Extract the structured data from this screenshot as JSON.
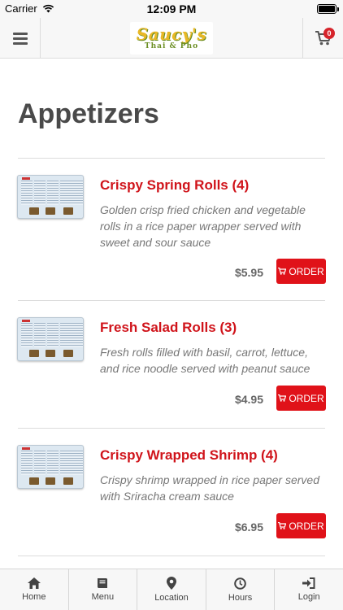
{
  "status_bar": {
    "carrier": "Carrier",
    "time": "12:09 PM"
  },
  "header": {
    "logo_text": "Saucy's",
    "logo_subtext": "Thai & Pho",
    "cart_count": "0"
  },
  "section": {
    "title": "Appetizers"
  },
  "items": [
    {
      "name": "Crispy Spring Rolls (4)",
      "description": "Golden crisp fried chicken and vegetable rolls in a rice paper wrapper served with sweet and sour sauce",
      "price": "$5.95",
      "order_label": "ORDER"
    },
    {
      "name": "Fresh Salad Rolls (3)",
      "description": "Fresh rolls filled with basil, carrot, lettuce, and rice noodle served with peanut sauce",
      "price": "$4.95",
      "order_label": "ORDER"
    },
    {
      "name": "Crispy Wrapped Shrimp (4)",
      "description": "Crispy shrimp wrapped in rice paper served with Sriracha cream sauce",
      "price": "$6.95",
      "order_label": "ORDER"
    }
  ],
  "tabbar": {
    "tabs": [
      {
        "label": "Home",
        "icon": "home-icon"
      },
      {
        "label": "Menu",
        "icon": "menu-book-icon"
      },
      {
        "label": "Location",
        "icon": "map-pin-icon"
      },
      {
        "label": "Hours",
        "icon": "clock-icon"
      },
      {
        "label": "Login",
        "icon": "login-icon"
      }
    ]
  },
  "colors": {
    "accent_red": "#e01219",
    "item_title_red": "#d0141b",
    "bar_background": "#f7f7f7"
  }
}
